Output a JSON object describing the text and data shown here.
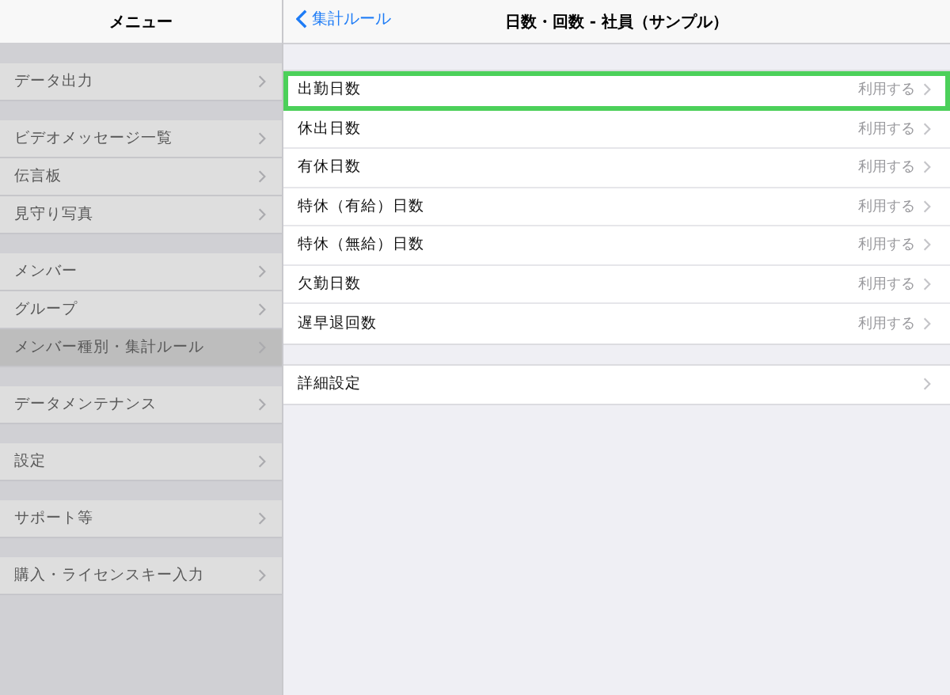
{
  "sidebar": {
    "title": "メニュー",
    "dimmed": true,
    "groups": [
      {
        "items": [
          {
            "label": "データ出力",
            "selected": false
          }
        ]
      },
      {
        "items": [
          {
            "label": "ビデオメッセージ一覧",
            "selected": false
          },
          {
            "label": "伝言板",
            "selected": false
          },
          {
            "label": "見守り写真",
            "selected": false
          }
        ]
      },
      {
        "items": [
          {
            "label": "メンバー",
            "selected": false
          },
          {
            "label": "グループ",
            "selected": false
          },
          {
            "label": "メンバー種別・集計ルール",
            "selected": true
          }
        ]
      },
      {
        "items": [
          {
            "label": "データメンテナンス",
            "selected": false
          }
        ]
      },
      {
        "items": [
          {
            "label": "設定",
            "selected": false
          }
        ]
      },
      {
        "items": [
          {
            "label": "サポート等",
            "selected": false
          }
        ]
      },
      {
        "items": [
          {
            "label": "購入・ライセンスキー入力",
            "selected": false
          }
        ]
      }
    ]
  },
  "detail": {
    "back": "集計ルール",
    "title": "日数・回数 - 社員（サンプル）",
    "groups": [
      {
        "rows": [
          {
            "label": "出勤日数",
            "value": "利用する",
            "highlighted": true
          },
          {
            "label": "休出日数",
            "value": "利用する",
            "highlighted": false
          },
          {
            "label": "有休日数",
            "value": "利用する",
            "highlighted": false
          },
          {
            "label": "特休（有給）日数",
            "value": "利用する",
            "highlighted": false
          },
          {
            "label": "特休（無給）日数",
            "value": "利用する",
            "highlighted": false
          },
          {
            "label": "欠勤日数",
            "value": "利用する",
            "highlighted": false
          },
          {
            "label": "遅早退回数",
            "value": "利用する",
            "highlighted": false
          }
        ]
      },
      {
        "rows": [
          {
            "label": "詳細設定",
            "highlighted": false
          }
        ]
      }
    ]
  }
}
